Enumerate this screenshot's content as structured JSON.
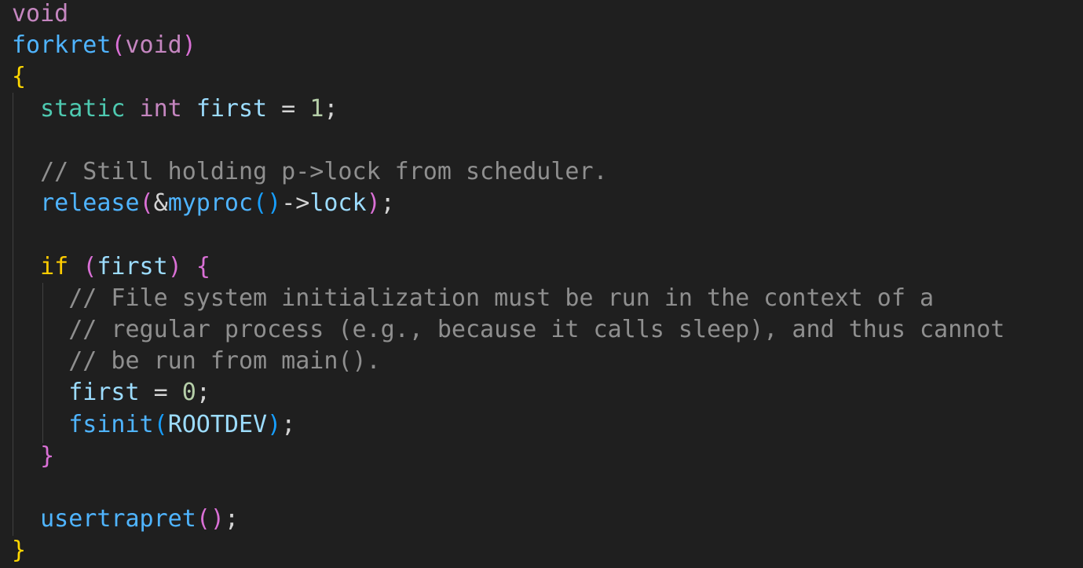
{
  "editor": {
    "theme_colors": {
      "background": "#1f1f1f",
      "keyword": "#c586c0",
      "function": "#4fb4ff",
      "storage": "#4ec9b0",
      "variable": "#9cdcfe",
      "number": "#b5cea8",
      "comment": "#8f8f8f",
      "control": "#ffcc00",
      "bracket_1": "#ffd700",
      "bracket_2": "#da70d6",
      "bracket_3": "#179fff",
      "indent_guide": "#404040"
    },
    "lines": [
      {
        "tokens": [
          {
            "text": "void",
            "kind": "type"
          }
        ]
      },
      {
        "tokens": [
          {
            "text": "forkret",
            "kind": "func"
          },
          {
            "text": "(",
            "kind": "b2"
          },
          {
            "text": "void",
            "kind": "type"
          },
          {
            "text": ")",
            "kind": "b2"
          }
        ]
      },
      {
        "tokens": [
          {
            "text": "{",
            "kind": "b1"
          }
        ]
      },
      {
        "tokens": [
          {
            "text": "  ",
            "kind": "op"
          },
          {
            "text": "static",
            "kind": "storage"
          },
          {
            "text": " ",
            "kind": "op"
          },
          {
            "text": "int",
            "kind": "type"
          },
          {
            "text": " ",
            "kind": "op"
          },
          {
            "text": "first",
            "kind": "var"
          },
          {
            "text": " = ",
            "kind": "op"
          },
          {
            "text": "1",
            "kind": "num"
          },
          {
            "text": ";",
            "kind": "op"
          }
        ]
      },
      {
        "tokens": []
      },
      {
        "tokens": [
          {
            "text": "  ",
            "kind": "op"
          },
          {
            "text": "// Still holding p->lock from scheduler.",
            "kind": "comment"
          }
        ]
      },
      {
        "tokens": [
          {
            "text": "  ",
            "kind": "op"
          },
          {
            "text": "release",
            "kind": "func"
          },
          {
            "text": "(",
            "kind": "b2"
          },
          {
            "text": "&",
            "kind": "op"
          },
          {
            "text": "myproc",
            "kind": "func"
          },
          {
            "text": "()",
            "kind": "b3"
          },
          {
            "text": "->",
            "kind": "op"
          },
          {
            "text": "lock",
            "kind": "var"
          },
          {
            "text": ")",
            "kind": "b2"
          },
          {
            "text": ";",
            "kind": "op"
          }
        ]
      },
      {
        "tokens": []
      },
      {
        "tokens": [
          {
            "text": "  ",
            "kind": "op"
          },
          {
            "text": "if",
            "kind": "if"
          },
          {
            "text": " ",
            "kind": "op"
          },
          {
            "text": "(",
            "kind": "b2"
          },
          {
            "text": "first",
            "kind": "var"
          },
          {
            "text": ")",
            "kind": "b2"
          },
          {
            "text": " ",
            "kind": "op"
          },
          {
            "text": "{",
            "kind": "b2"
          }
        ]
      },
      {
        "tokens": [
          {
            "text": "    ",
            "kind": "op"
          },
          {
            "text": "// File system initialization must be run in the context of a",
            "kind": "comment"
          }
        ]
      },
      {
        "tokens": [
          {
            "text": "    ",
            "kind": "op"
          },
          {
            "text": "// regular process (e.g., because it calls sleep), and thus cannot",
            "kind": "comment"
          }
        ]
      },
      {
        "tokens": [
          {
            "text": "    ",
            "kind": "op"
          },
          {
            "text": "// be run from main().",
            "kind": "comment"
          }
        ]
      },
      {
        "tokens": [
          {
            "text": "    ",
            "kind": "op"
          },
          {
            "text": "first",
            "kind": "var"
          },
          {
            "text": " = ",
            "kind": "op"
          },
          {
            "text": "0",
            "kind": "num"
          },
          {
            "text": ";",
            "kind": "op"
          }
        ]
      },
      {
        "tokens": [
          {
            "text": "    ",
            "kind": "op"
          },
          {
            "text": "fsinit",
            "kind": "func"
          },
          {
            "text": "(",
            "kind": "b3"
          },
          {
            "text": "ROOTDEV",
            "kind": "var"
          },
          {
            "text": ")",
            "kind": "b3"
          },
          {
            "text": ";",
            "kind": "op"
          }
        ]
      },
      {
        "tokens": [
          {
            "text": "  ",
            "kind": "op"
          },
          {
            "text": "}",
            "kind": "b2"
          }
        ]
      },
      {
        "tokens": []
      },
      {
        "tokens": [
          {
            "text": "  ",
            "kind": "op"
          },
          {
            "text": "usertrapret",
            "kind": "func"
          },
          {
            "text": "()",
            "kind": "b2"
          },
          {
            "text": ";",
            "kind": "op"
          }
        ]
      },
      {
        "tokens": [
          {
            "text": "}",
            "kind": "b1"
          }
        ]
      }
    ]
  }
}
